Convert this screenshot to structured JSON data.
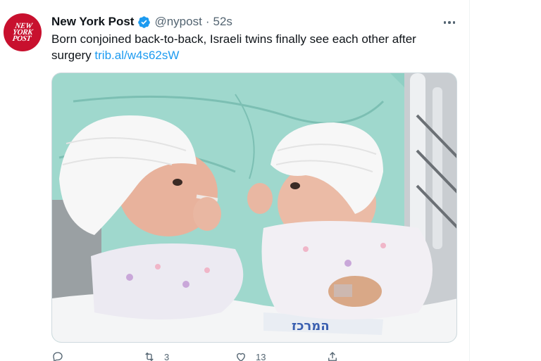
{
  "tweet": {
    "avatar_logo_lines": [
      "NEW",
      "YORK",
      "POST"
    ],
    "display_name": "New York Post",
    "handle": "@nypost",
    "separator": "·",
    "timestamp": "52s",
    "text": "Born conjoined back-to-back, Israeli twins finally see each other after surgery",
    "link": "trib.al/w4s62sW",
    "media_caption_text": "המרכז"
  },
  "actions": {
    "reply_count": "",
    "retweet_count": "3",
    "like_count": "13",
    "share_count": ""
  },
  "colors": {
    "brand_red": "#c8102e",
    "link_blue": "#1d9bf0",
    "verified_blue": "#1d9bf0",
    "muted_gray": "#536471"
  },
  "icons": {
    "verified": "verified-badge-icon",
    "more": "more-dots-icon",
    "reply": "reply-icon",
    "retweet": "retweet-icon",
    "like": "heart-icon",
    "share": "share-icon"
  }
}
